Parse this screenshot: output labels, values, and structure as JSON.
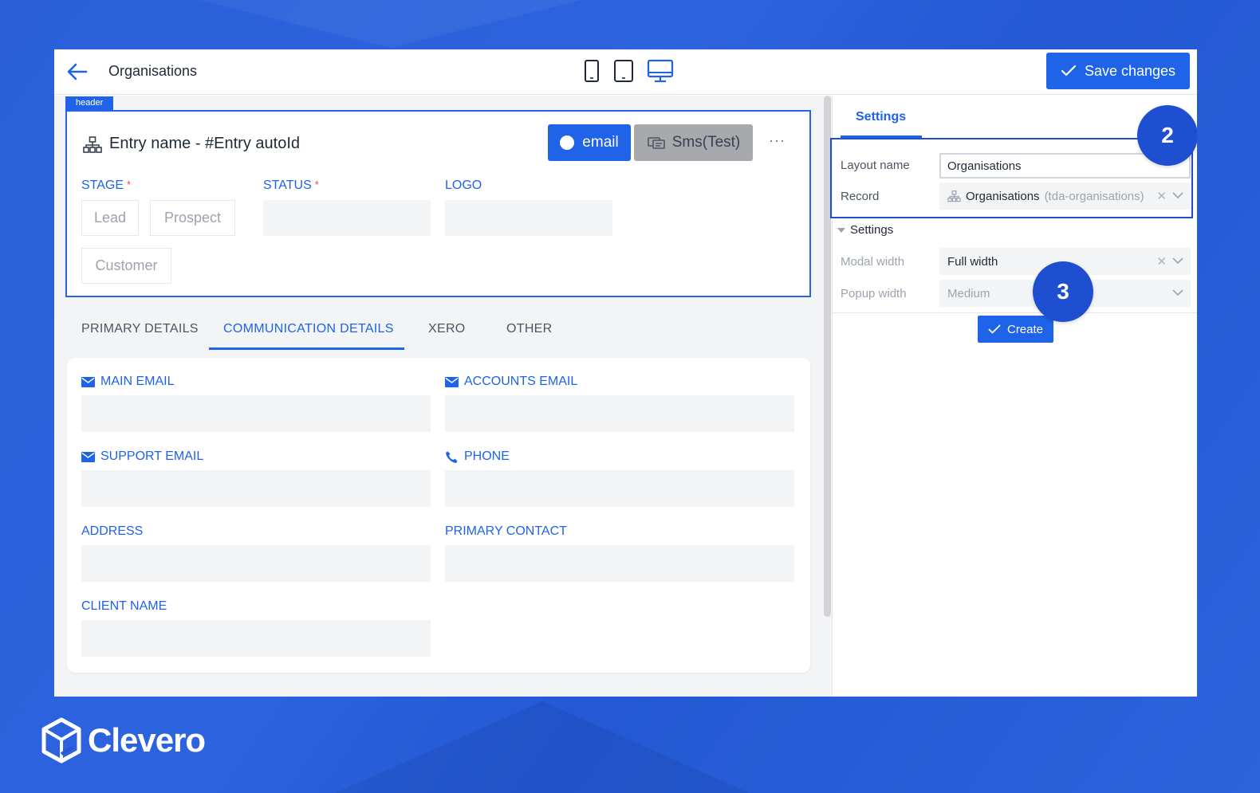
{
  "topbar": {
    "title": "Organisations",
    "save_label": "Save changes"
  },
  "header_block": {
    "tag": "header",
    "entry_title": "Entry name - #Entry autoId",
    "email_label": "email",
    "sms_label": "Sms(Test)",
    "more_label": "···",
    "stage_label": "STAGE",
    "status_label": "STATUS",
    "logo_label": "LOGO",
    "required_mark": "*",
    "stage_options": [
      "Lead",
      "Prospect",
      "Customer"
    ]
  },
  "tabs": [
    "PRIMARY DETAILS",
    "COMMUNICATION DETAILS",
    "XERO",
    "OTHER"
  ],
  "comm_fields": {
    "main_email": "MAIN EMAIL",
    "accounts_email": "ACCOUNTS EMAIL",
    "support_email": "SUPPORT EMAIL",
    "phone": "PHONE",
    "address": "ADDRESS",
    "primary_contact": "PRIMARY CONTACT",
    "client_name": "CLIENT NAME"
  },
  "sidepanel": {
    "tab_label": "Settings",
    "layout_name_label": "Layout name",
    "layout_name_value": "Organisations",
    "record_label": "Record",
    "record_value": "Organisations",
    "record_sub": "(tda-organisations)",
    "section_label": "Settings",
    "modal_width_label": "Modal width",
    "modal_width_value": "Full width",
    "popup_width_label": "Popup width",
    "popup_width_value": "Medium",
    "create_label": "Create",
    "clear_symbol": "✕"
  },
  "badges": {
    "step2": "2",
    "step3": "3"
  },
  "brand": {
    "name": "Clevero"
  },
  "colors": {
    "accent": "#1e63e8",
    "background": "#2559d6",
    "highlight": "#1e4fd1"
  }
}
